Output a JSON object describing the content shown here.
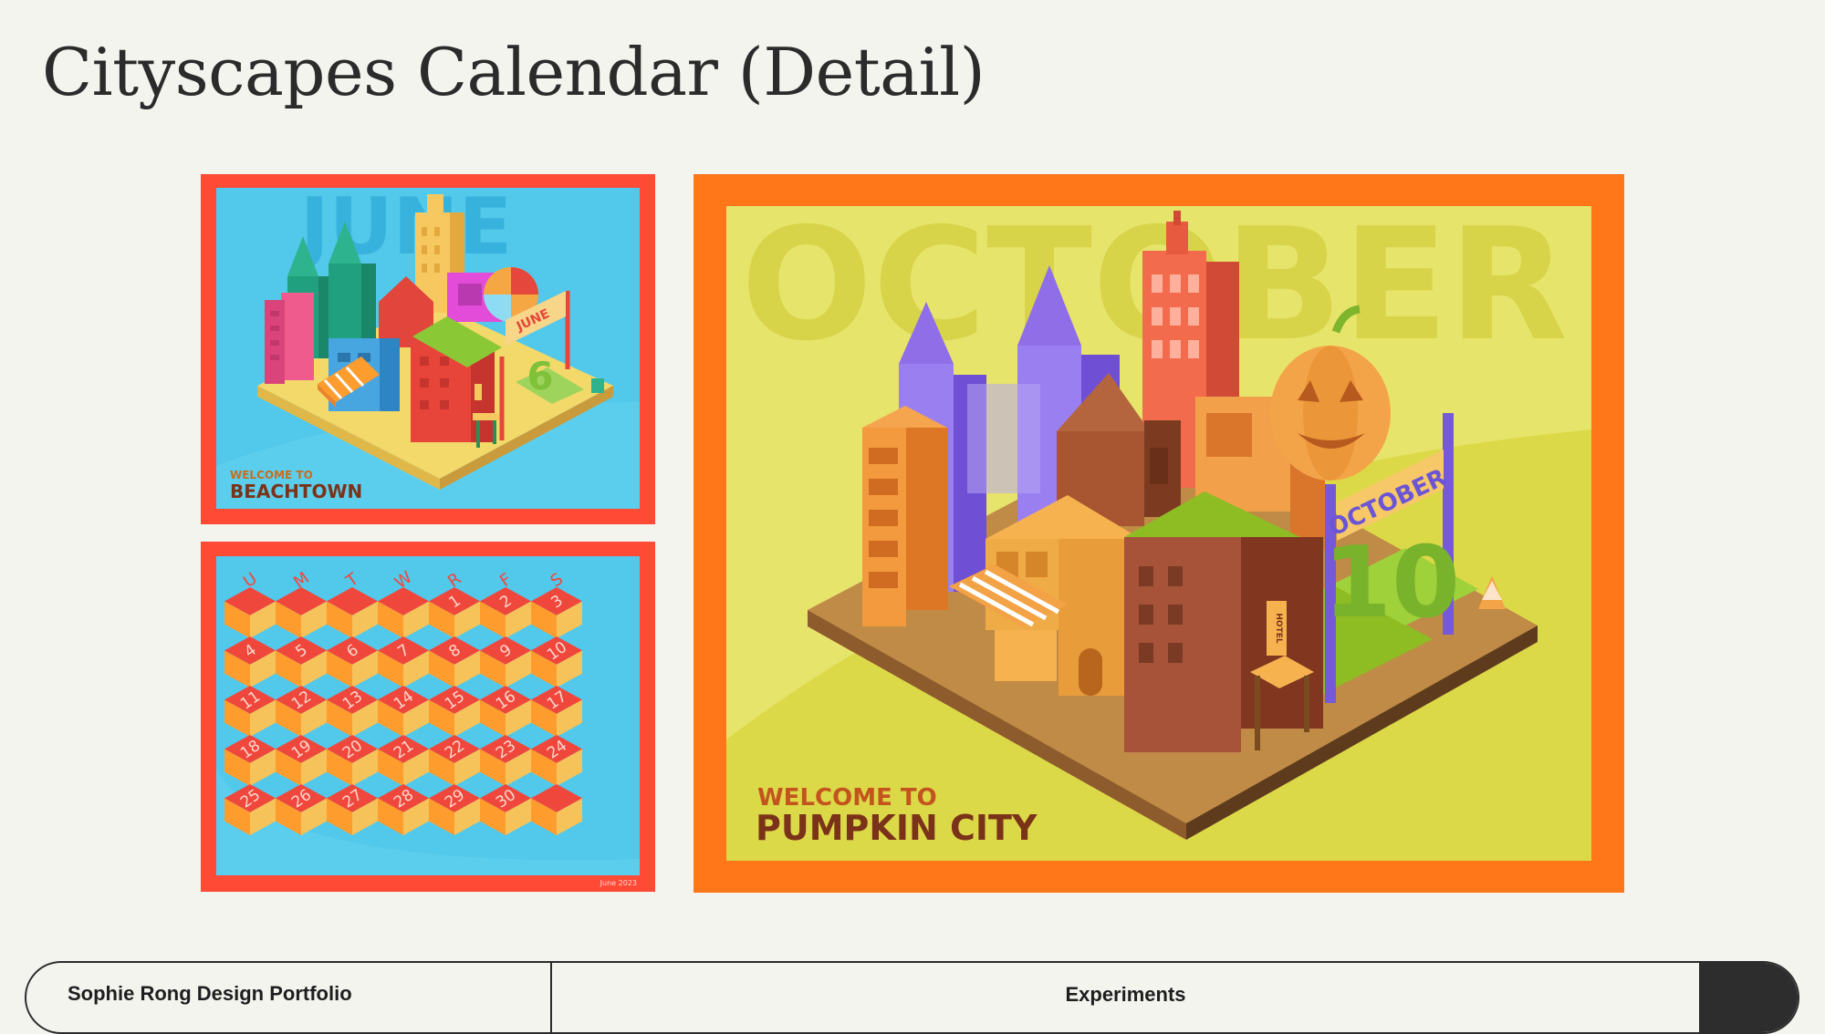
{
  "page": {
    "title": "Cityscapes Calendar (Detail)"
  },
  "june_card": {
    "month_watermark": "JUNE",
    "sign_text": "JUNE",
    "day_number": "6",
    "welcome_line": "WELCOME TO",
    "city_name": "BEACHTOWN",
    "colors": {
      "frame": "#ff4a36",
      "background": "#52c8ea"
    }
  },
  "calendar_card": {
    "weekday_headers": [
      "U",
      "M",
      "T",
      "W",
      "R",
      "F",
      "S"
    ],
    "day_rows": [
      [
        "",
        "",
        "",
        "",
        "",
        "1",
        "2",
        "3"
      ],
      [
        "4",
        "5",
        "6",
        "7",
        "8",
        "9",
        "10"
      ],
      [
        "11",
        "12",
        "13",
        "14",
        "15",
        "16",
        "17"
      ],
      [
        "18",
        "19",
        "20",
        "21",
        "22",
        "23",
        "24"
      ],
      [
        "25",
        "26",
        "27",
        "28",
        "29",
        "30",
        ""
      ]
    ],
    "footer_note": "June 2023",
    "colors": {
      "frame": "#ff4a36",
      "background": "#52c8ea",
      "cube_top": "#f0473c",
      "cube_left": "#ff9c2e",
      "cube_right": "#f6c35a"
    }
  },
  "october_card": {
    "month_watermark": "OCTOBER",
    "sign_text": "OCTOBER",
    "day_number": "10",
    "hotel_sign": "HOTEL",
    "welcome_line": "WELCOME TO",
    "city_name": "PUMPKIN CITY",
    "colors": {
      "frame": "#ff7719",
      "background": "#e7e46c",
      "text_welcome": "#c3541e",
      "text_city": "#7a3319"
    }
  },
  "nav": {
    "left_label": "Sophie Rong Design Portfolio",
    "center_label": "Experiments"
  }
}
